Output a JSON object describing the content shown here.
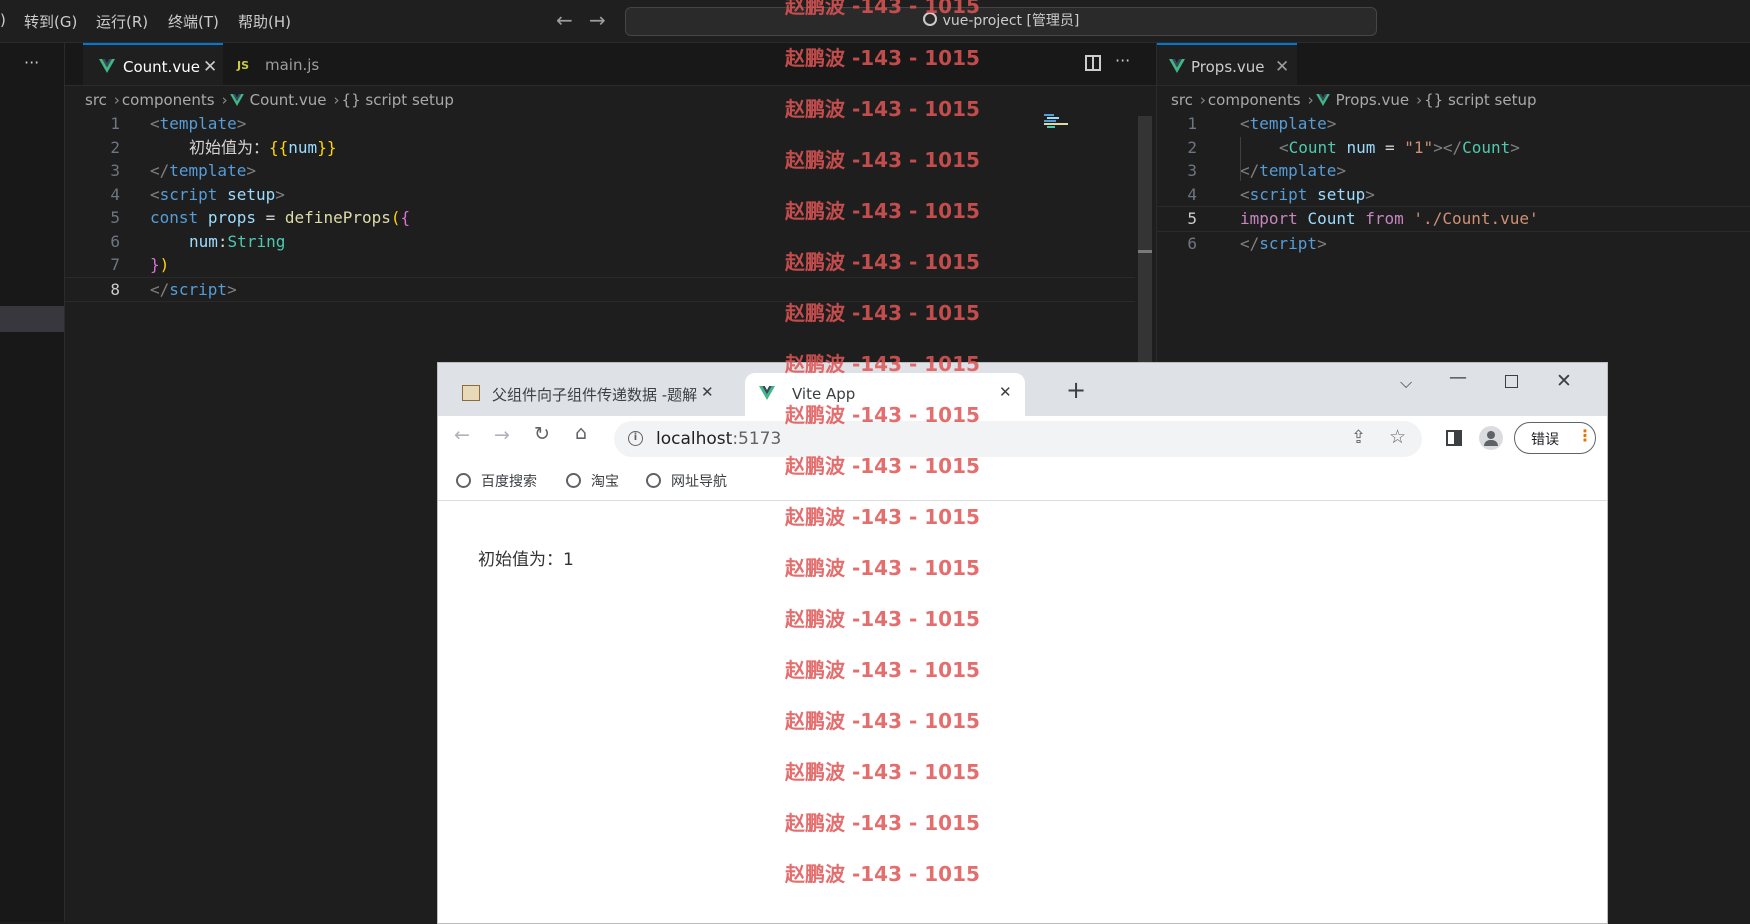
{
  "menu": [
    "转到(G)",
    "运行(R)",
    "终端(T)",
    "帮助(H)"
  ],
  "menu_left_fragment": ")",
  "command_center": "vue-project [管理员]",
  "sidebar_more": "···",
  "left_editor": {
    "tabs": [
      {
        "label": "Count.vue",
        "active": true,
        "icon": "vue-icon"
      },
      {
        "label": "main.js",
        "active": false,
        "icon": "js-icon",
        "badge": "JS"
      }
    ],
    "breadcrumb": [
      "src",
      "components",
      "Count.vue",
      "{} script setup"
    ],
    "current_line": 8,
    "line_numbers": [
      "1",
      "2",
      "3",
      "4",
      "5",
      "6",
      "7",
      "8"
    ]
  },
  "right_editor": {
    "tabs": [
      {
        "label": "Props.vue",
        "active": true,
        "icon": "vue-icon"
      }
    ],
    "breadcrumb": [
      "src",
      "components",
      "Props.vue",
      "{} script setup"
    ],
    "current_line": 5,
    "line_numbers": [
      "1",
      "2",
      "3",
      "4",
      "5",
      "6"
    ]
  },
  "browser": {
    "tabs": [
      {
        "label": "父组件向子组件传递数据 -题解",
        "active": false
      },
      {
        "label": "Vite App",
        "active": true
      }
    ],
    "address": {
      "host": "localhost",
      "port": ":5173"
    },
    "bookmarks": [
      "百度搜索",
      "淘宝",
      "网址导航"
    ],
    "error_button": "错误",
    "page_text": "初始值为：1"
  },
  "watermark": "赵鹏波 -143 - 1015",
  "colors": {
    "accent": "#0078d4",
    "vue_green": "#41b883",
    "watermark": "#e05555"
  }
}
